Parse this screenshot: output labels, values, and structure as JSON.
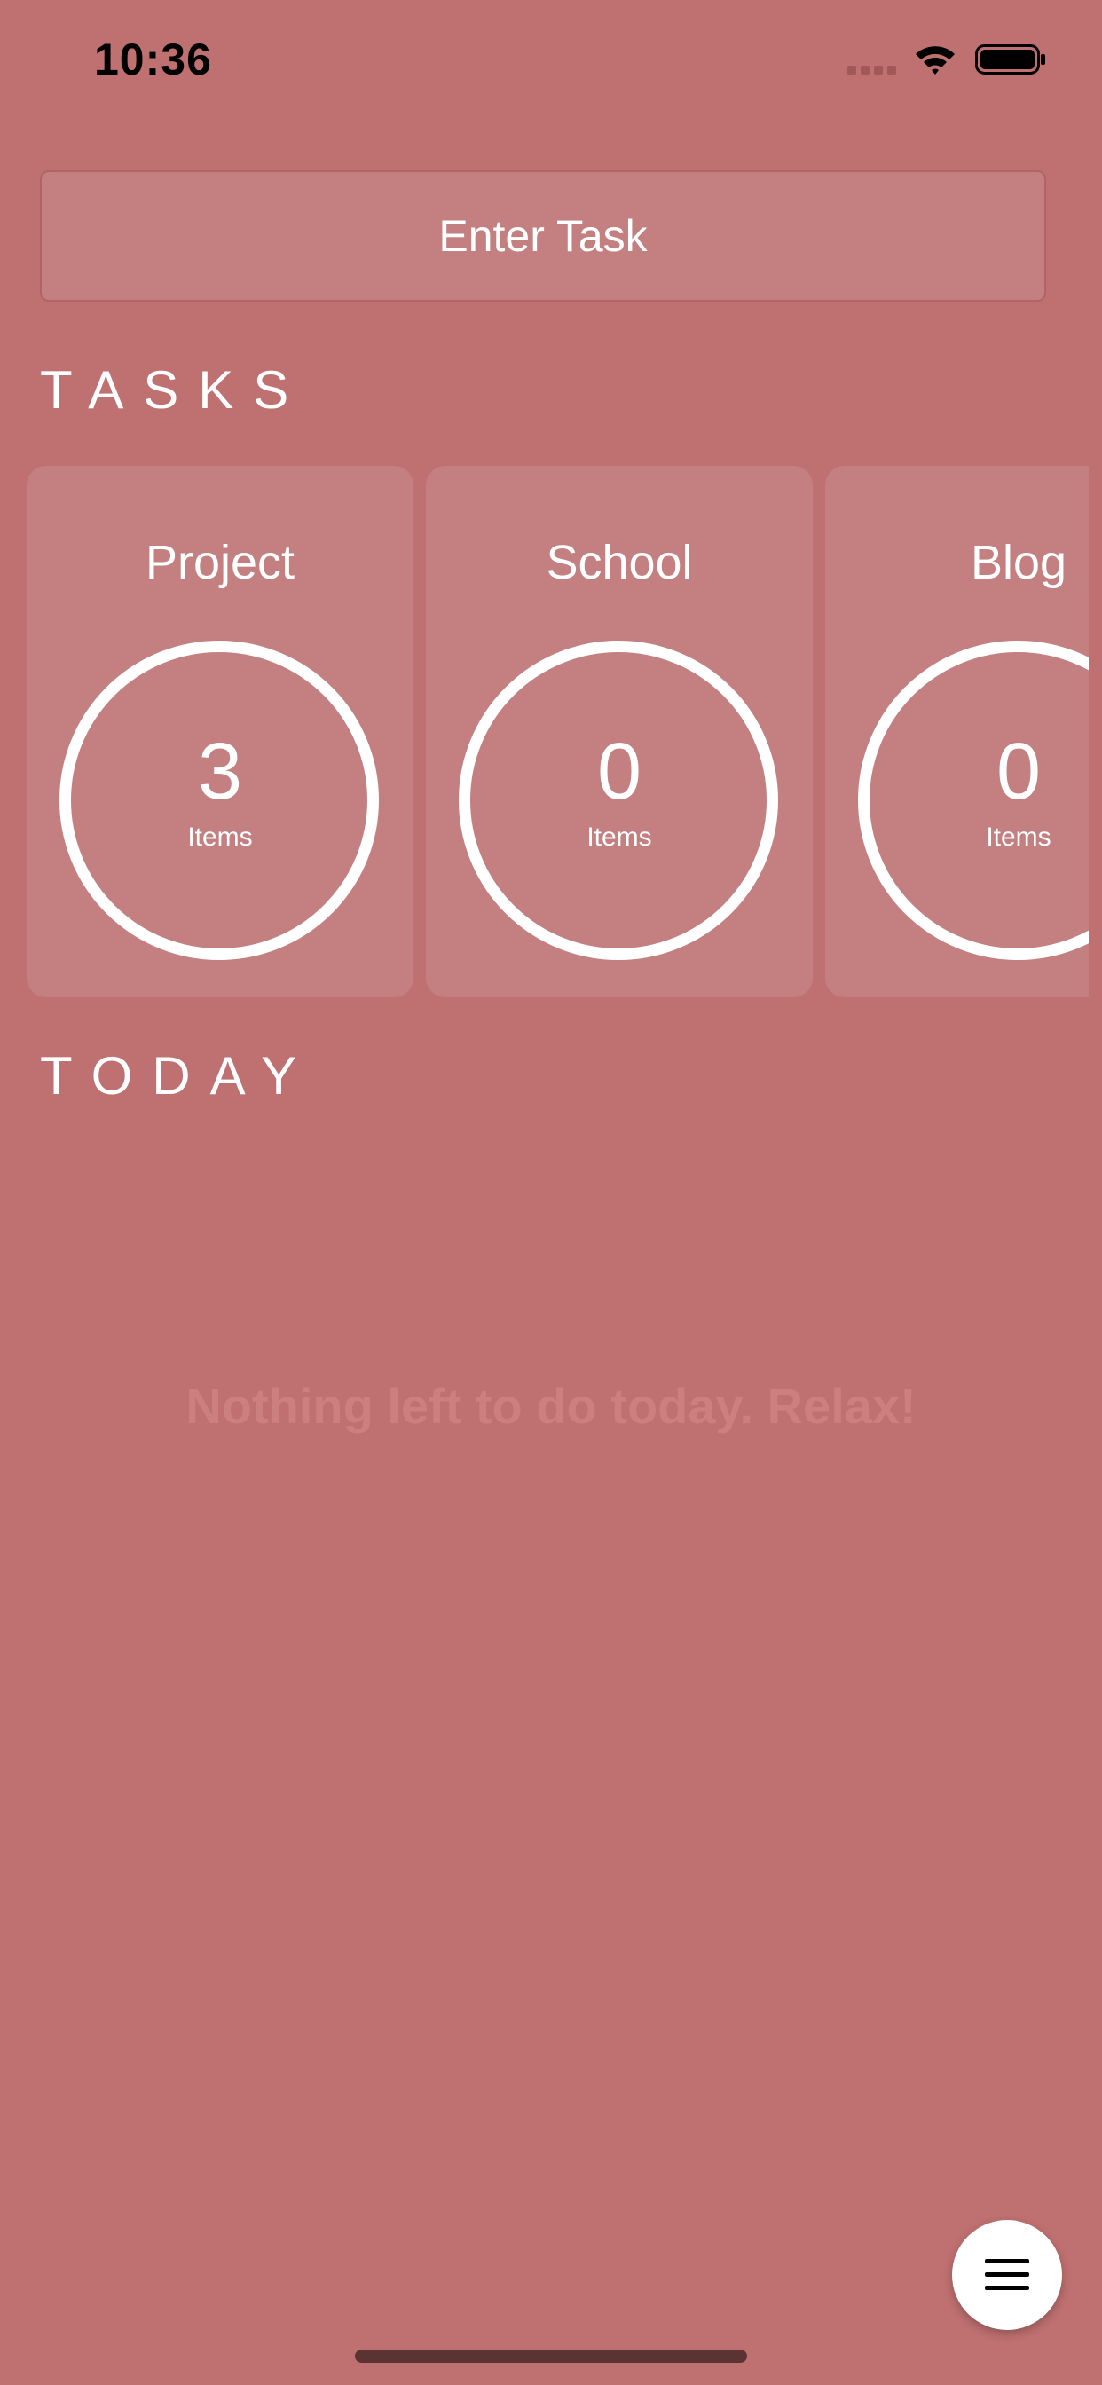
{
  "status_bar": {
    "time": "10:36"
  },
  "task_input": {
    "placeholder": "Enter Task",
    "value": ""
  },
  "sections": {
    "tasks_heading": "TASKS",
    "today_heading": "TODAY"
  },
  "task_cards": [
    {
      "title": "Project",
      "count": "3",
      "unit": "Items"
    },
    {
      "title": "School",
      "count": "0",
      "unit": "Items"
    },
    {
      "title": "Blog",
      "count": "0",
      "unit": "Items"
    }
  ],
  "today": {
    "empty_message": "Nothing left to do today. Relax!"
  },
  "menu_button": {
    "icon": "hamburger-menu-icon"
  },
  "colors": {
    "background": "#bf7070",
    "card": "#c48080",
    "ring": "#ffffff",
    "empty_text": "#cb7f7f"
  }
}
